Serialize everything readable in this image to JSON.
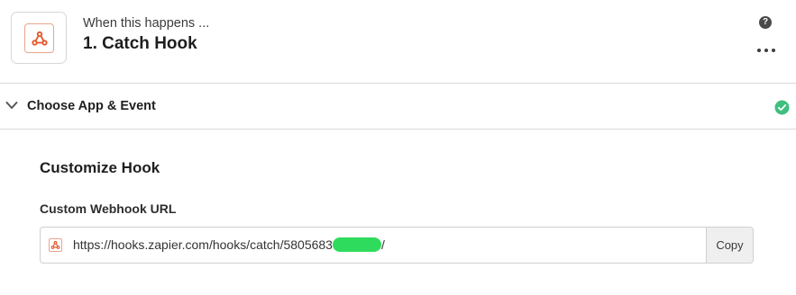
{
  "header": {
    "subtitle": "When this happens ...",
    "title": "1. Catch Hook",
    "help_label": "?"
  },
  "icons": {
    "app": "webhook-icon",
    "help": "question-circle-icon",
    "more": "more-horizontal-icon",
    "chevron": "chevron-down-icon",
    "status": "check-circle-icon"
  },
  "section": {
    "label": "Choose App & Event",
    "status": "complete"
  },
  "customize": {
    "title": "Customize Hook",
    "field_label": "Custom Webhook URL",
    "url_prefix": "https://hooks.zapier.com/hooks/catch/5805683",
    "url_suffix": "/",
    "copy_label": "Copy"
  },
  "colors": {
    "brand_accent": "#ff4a00",
    "success": "#3fbf7f",
    "redaction": "#2fdb5c"
  }
}
